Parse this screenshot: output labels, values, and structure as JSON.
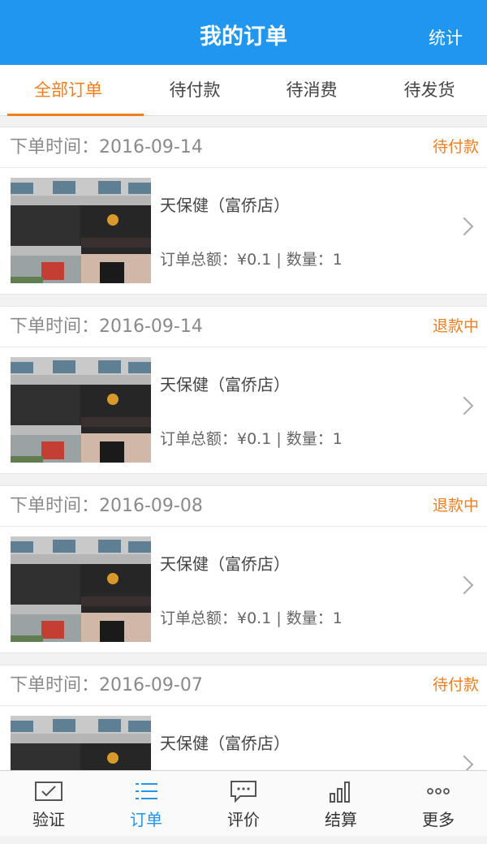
{
  "header": {
    "title": "我的订单",
    "stats_label": "统计"
  },
  "tabs": [
    {
      "label": "全部订单",
      "active": true
    },
    {
      "label": "待付款",
      "active": false
    },
    {
      "label": "待消费",
      "active": false
    },
    {
      "label": "待发货",
      "active": false
    }
  ],
  "orders": [
    {
      "time": "下单时间：2016-09-14",
      "status": "待付款",
      "name": "天保健（富侨店）",
      "meta": "订单总额：¥0.1 | 数量：1"
    },
    {
      "time": "下单时间：2016-09-14",
      "status": "退款中",
      "name": "天保健（富侨店）",
      "meta": "订单总额：¥0.1 | 数量：1"
    },
    {
      "time": "下单时间：2016-09-08",
      "status": "退款中",
      "name": "天保健（富侨店）",
      "meta": "订单总额：¥0.1 | 数量：1"
    },
    {
      "time": "下单时间：2016-09-07",
      "status": "待付款",
      "name": "天保健（富侨店）",
      "meta": ""
    }
  ],
  "tabbar": [
    {
      "label": "验证",
      "icon": "envelope-check-icon",
      "active": false
    },
    {
      "label": "订单",
      "icon": "list-icon",
      "active": true
    },
    {
      "label": "评价",
      "icon": "chat-bubble-icon",
      "active": false
    },
    {
      "label": "结算",
      "icon": "bar-chart-icon",
      "active": false
    },
    {
      "label": "更多",
      "icon": "more-dots-icon",
      "active": false
    }
  ],
  "colors": {
    "header": "#2196f0",
    "accent": "#f07e1e",
    "active_tab": "#2196f0"
  }
}
